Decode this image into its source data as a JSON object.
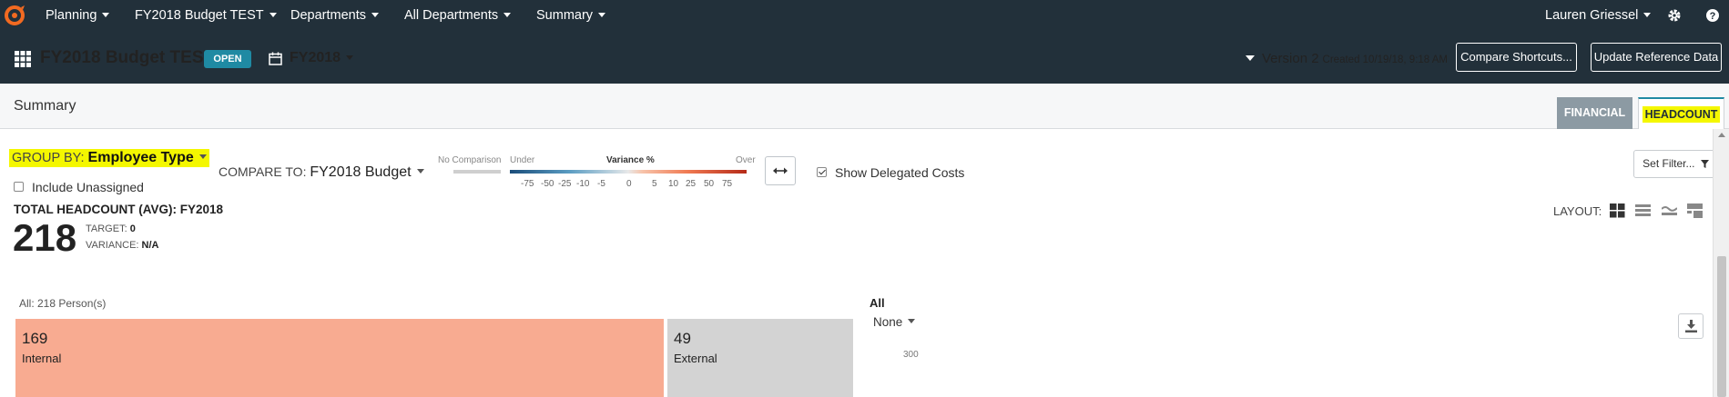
{
  "topnav": {
    "items": [
      {
        "label": "Planning"
      },
      {
        "label": "FY2018 Budget TEST"
      },
      {
        "label": "Departments"
      },
      {
        "label": "All Departments"
      },
      {
        "label": "Summary"
      }
    ],
    "user": "Lauren Griessel"
  },
  "header": {
    "title": "FY2018 Budget TEST",
    "status_badge": "OPEN",
    "fiscal_year": "FY2018",
    "version": "Version 2",
    "created": "Created 10/19/18, 9:18 AM",
    "compare_shortcuts": "Compare Shortcuts...",
    "update_reference": "Update Reference Data"
  },
  "summary": {
    "title": "Summary",
    "tabs": [
      {
        "label": "FINANCIAL",
        "active": false
      },
      {
        "label": "HEADCOUNT",
        "active": true
      }
    ]
  },
  "controls": {
    "group_by_label": "GROUP BY:",
    "group_by_value": "Employee Type",
    "include_unassigned": "Include Unassigned",
    "compare_to_label": "COMPARE TO:",
    "compare_to_value": "FY2018 Budget",
    "show_delegated": "Show Delegated Costs",
    "show_delegated_checked": true,
    "set_filter": "Set Filter..."
  },
  "legend": {
    "no_comparison": "No Comparison",
    "under": "Under",
    "variance": "Variance %",
    "over": "Over",
    "ticks": [
      "-75",
      "-50",
      "-25",
      "-10",
      "-5",
      "0",
      "5",
      "10",
      "25",
      "50",
      "75"
    ],
    "colors": {
      "low": "#1a4d7a",
      "mid": "#e8e8e8",
      "high": "#b52a18"
    }
  },
  "totals": {
    "title": "TOTAL HEADCOUNT (AVG): FY2018",
    "value": "218",
    "target_label": "TARGET:",
    "target_value": "0",
    "variance_label": "VARIANCE:",
    "variance_value": "N/A"
  },
  "layout": {
    "label": "LAYOUT:"
  },
  "treemap": {
    "caption": "All: 218 Person(s)",
    "blocks": [
      {
        "value": "169",
        "label": "Internal",
        "color": "#f8ab91"
      },
      {
        "value": "49",
        "label": "External",
        "color": "#d3d3d3"
      }
    ]
  },
  "chart_panel": {
    "title": "All",
    "dropdown": "None",
    "axis_tick": "300"
  }
}
